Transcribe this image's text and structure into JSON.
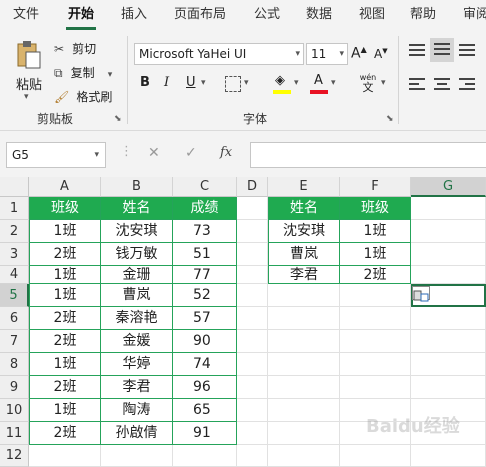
{
  "ribbon_tabs": [
    "文件",
    "开始",
    "插入",
    "页面布局",
    "公式",
    "数据",
    "视图",
    "帮助",
    "审阅"
  ],
  "active_tab": "开始",
  "clipboard": {
    "paste": "粘贴",
    "cut": "剪切",
    "copy": "复制",
    "format_painter": "格式刷",
    "group_label": "剪贴板"
  },
  "font": {
    "name": "Microsoft YaHei UI",
    "size": "11",
    "grow": "A",
    "shrink": "A",
    "bold": "B",
    "italic": "I",
    "underline": "U",
    "font_color_glyph": "A",
    "phonetic": "wén",
    "phonetic_sub": "文",
    "group_label": "字体"
  },
  "formula_bar": {
    "name_box": "G5",
    "cancel": "✕",
    "enter": "✓",
    "fx": "fx",
    "content": ""
  },
  "columns": [
    "A",
    "B",
    "C",
    "D",
    "E",
    "F",
    "G"
  ],
  "selected_column": "G",
  "rows": [
    "1",
    "2",
    "3",
    "4",
    "5",
    "6",
    "7",
    "8",
    "9",
    "10",
    "11",
    "12"
  ],
  "selected_row": "5",
  "table1": {
    "headers": [
      "班级",
      "姓名",
      "成绩"
    ],
    "rows": [
      [
        "1班",
        "沈安琪",
        "73"
      ],
      [
        "2班",
        "钱万敏",
        "51"
      ],
      [
        "1班",
        "金珊",
        "77"
      ],
      [
        "1班",
        "曹岚",
        "52"
      ],
      [
        "2班",
        "秦溶艳",
        "57"
      ],
      [
        "2班",
        "金媛",
        "90"
      ],
      [
        "1班",
        "华婷",
        "74"
      ],
      [
        "2班",
        "李君",
        "96"
      ],
      [
        "1班",
        "陶涛",
        "65"
      ],
      [
        "2班",
        "孙啟倩",
        "91"
      ]
    ]
  },
  "table2": {
    "headers": [
      "姓名",
      "班级"
    ],
    "rows": [
      [
        "沈安琪",
        "1班"
      ],
      [
        "曹岚",
        "1班"
      ],
      [
        "李君",
        "2班"
      ]
    ]
  },
  "colors": {
    "accent": "#217346",
    "header_fill": "#1faa50",
    "font_color": "#e81123",
    "highlight": "#ffff00"
  },
  "watermark": "Baidu经验"
}
